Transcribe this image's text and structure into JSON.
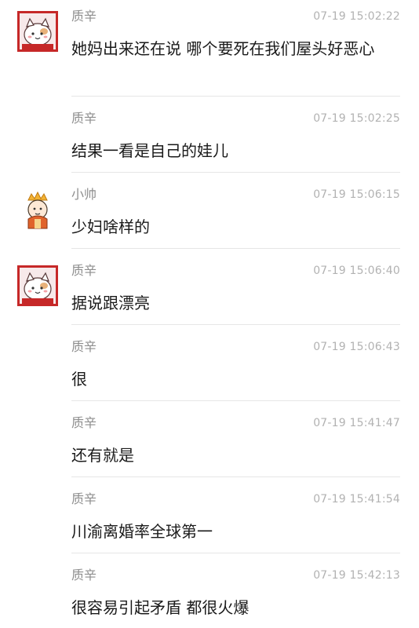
{
  "messages": [
    {
      "sender": "质辛",
      "time": "07-19 15:02:22",
      "text": "她妈出来还在说 哪个要死在我们屋头好恶心",
      "avatar": "cat-avatar-icon"
    },
    {
      "sender": "质辛",
      "time": "07-19 15:02:25",
      "text": "结果一看是自己的娃儿",
      "avatar": null
    },
    {
      "sender": "小帅",
      "time": "07-19 15:06:15",
      "text": "少妇啥样的",
      "avatar": "cartoon-person-avatar-icon"
    },
    {
      "sender": "质辛",
      "time": "07-19 15:06:40",
      "text": "据说跟漂亮",
      "avatar": "cat-avatar-icon"
    },
    {
      "sender": "质辛",
      "time": "07-19 15:06:43",
      "text": "很",
      "avatar": null
    },
    {
      "sender": "质辛",
      "time": "07-19 15:41:47",
      "text": "还有就是",
      "avatar": null
    },
    {
      "sender": "质辛",
      "time": "07-19 15:41:54",
      "text": "川渝离婚率全球第一",
      "avatar": null
    },
    {
      "sender": "质辛",
      "time": "07-19 15:42:13",
      "text": "很容易引起矛盾 都很火爆",
      "avatar": null
    }
  ],
  "colors": {
    "name": "#8e8e8e",
    "time": "#b2b2b2",
    "text": "#1a1a1a",
    "divider": "#e6e6e6",
    "cat_avatar_bg": "#c62828"
  }
}
